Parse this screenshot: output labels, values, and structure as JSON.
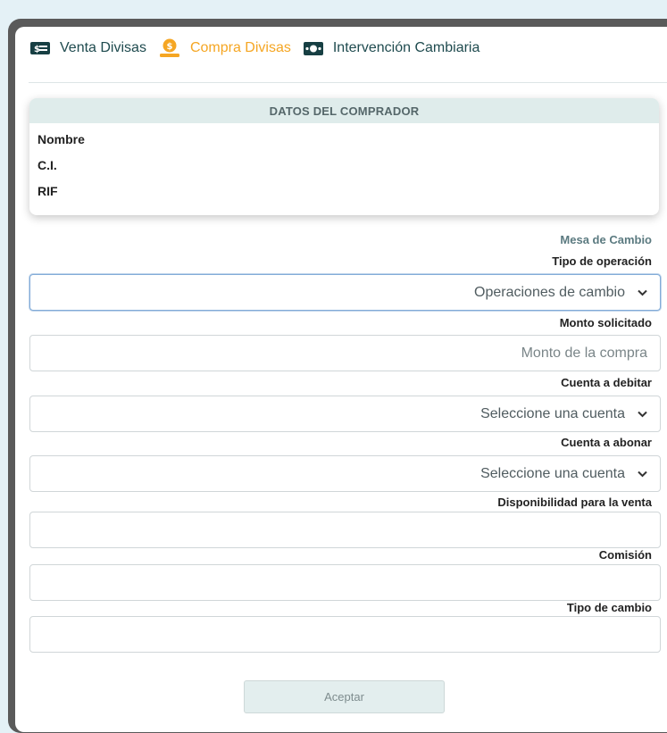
{
  "tabs": [
    {
      "label": "Venta Divisas",
      "icon": "money-bill-icon",
      "active": false
    },
    {
      "label": "Compra Divisas",
      "icon": "coin-hand-icon",
      "active": true
    },
    {
      "label": "Intervención Cambiaria",
      "icon": "cash-icon",
      "active": false
    }
  ],
  "buyer": {
    "header": "DATOS DEL COMPRADOR",
    "name_label": "Nombre",
    "ci_label": "C.I.",
    "rif_label": "RIF"
  },
  "form": {
    "section_title": "Mesa de Cambio",
    "operation_type_label": "Tipo de operación",
    "operation_type_value": "Operaciones de cambio",
    "amount_label": "Monto solicitado",
    "amount_placeholder": "Monto de la compra",
    "debit_account_label": "Cuenta a debitar",
    "debit_account_value": "Seleccione una cuenta",
    "credit_account_label": "Cuenta a abonar",
    "credit_account_value": "Seleccione una cuenta",
    "availability_label": "Disponibilidad para la venta",
    "commission_label": "Comisión",
    "exchange_rate_label": "Tipo de cambio",
    "submit_label": "Aceptar"
  },
  "colors": {
    "accent": "#f5a623",
    "tab_text": "#1f4b4f",
    "section_title": "#5b7a80",
    "card_header_bg": "#dfeceb"
  }
}
